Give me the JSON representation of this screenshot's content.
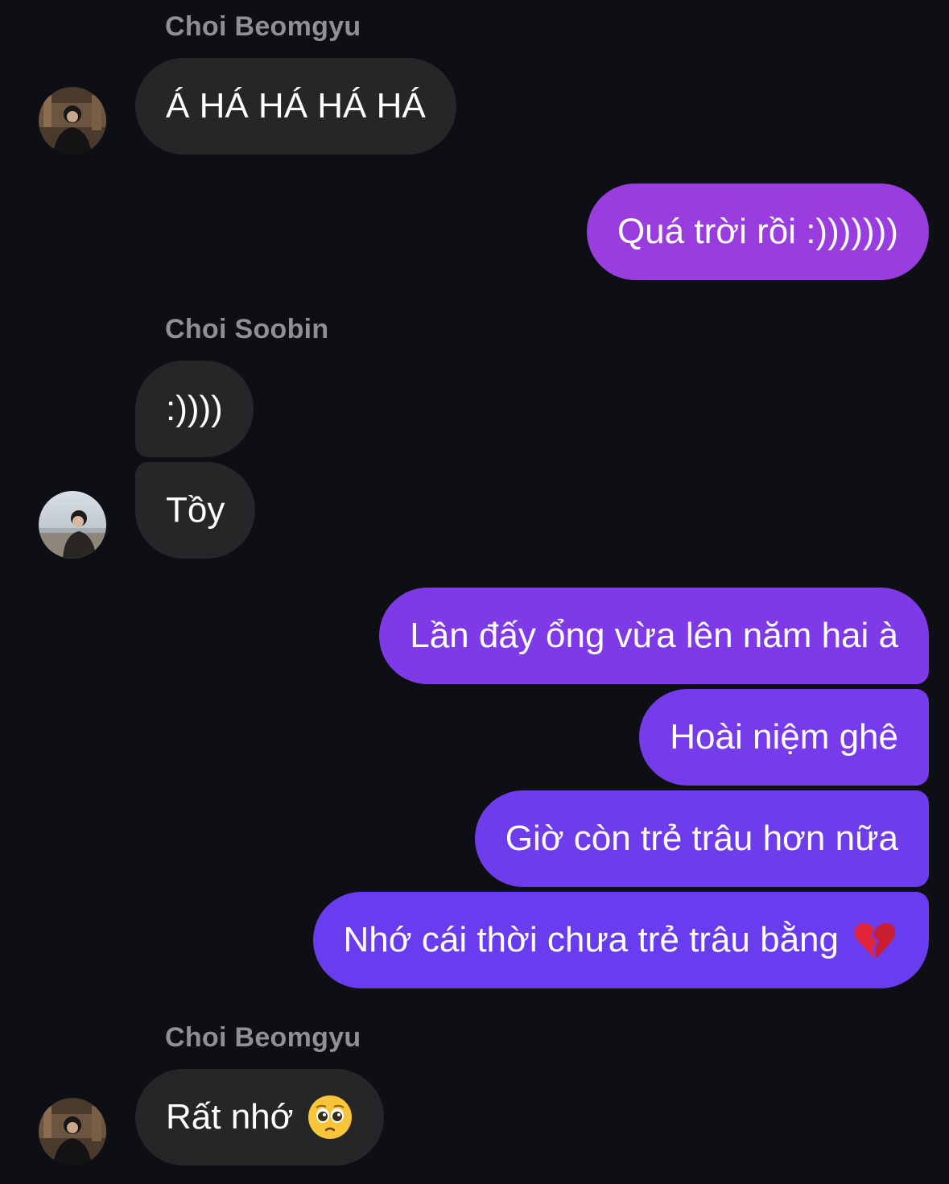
{
  "colors": {
    "background": "#0d0f14",
    "incoming_bubble": "#262629",
    "outgoing_gradient_top": "#9c3fe0",
    "outgoing_gradient_bottom": "#6a3cef",
    "sender_name": "#8e9096"
  },
  "groups": [
    {
      "sender": "Choi Beomgyu",
      "avatar": "beomgyu-avatar",
      "messages": [
        "Á HÁ HÁ HÁ HÁ"
      ]
    },
    {
      "outgoing": true,
      "messages": [
        "Quá trời rồi :)))))))"
      ]
    },
    {
      "sender": "Choi Soobin",
      "avatar": "soobin-avatar",
      "messages": [
        ":))))",
        "Tồy"
      ]
    },
    {
      "outgoing": true,
      "messages": [
        "Lần đấy ổng vừa lên năm hai à",
        "Hoài niệm ghê",
        "Giờ còn trẻ trâu hơn nữa",
        "Nhớ cái thời chưa trẻ trâu bằng"
      ],
      "emoji": "broken-heart-icon"
    },
    {
      "sender": "Choi Beomgyu",
      "avatar": "beomgyu-avatar",
      "messages": [
        "Rất nhớ"
      ],
      "emoji": "pleading-face-icon"
    }
  ]
}
